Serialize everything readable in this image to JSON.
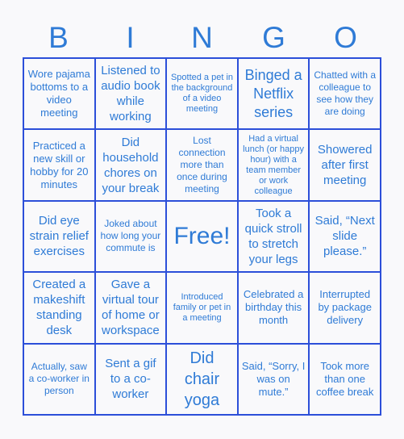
{
  "header": {
    "letters": [
      "B",
      "I",
      "N",
      "G",
      "O"
    ]
  },
  "board": {
    "cells": [
      "Wore pajama bottoms to a video meeting",
      "Listened to audio book while working",
      "Spotted a pet in the background of a video meeting",
      "Binged a Netflix series",
      "Chatted with a colleague to see how they are doing",
      "Practiced a new skill or hobby for 20 minutes",
      "Did household chores on your break",
      "Lost connection more than once during meeting",
      "Had a virtual lunch (or happy hour) with a team member or work colleague",
      "Showered after first meeting",
      "Did eye strain relief exercises",
      "Joked about how long your commute is",
      "Free!",
      "Took a quick stroll to stretch your legs",
      "Said, “Next slide please.”",
      "Created a makeshift standing desk",
      "Gave a virtual tour of home or workspace",
      "Introduced family or pet in a meeting",
      "Celebrated a birthday this month",
      "Interrupted by package delivery",
      "Actually, saw a co-worker in person",
      "Sent a gif to a co-worker",
      "Did chair yoga",
      "Said, “Sorry, I was on mute.”",
      "Took more than one coffee break"
    ]
  },
  "colors": {
    "text": "#2f7bd6",
    "grid": "#2c4fd9",
    "background": "#f9f9fb"
  }
}
